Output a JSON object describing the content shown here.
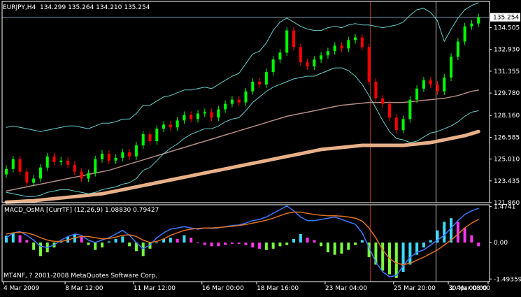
{
  "chart_data": [
    {
      "type": "line",
      "title": "EURJPY,H4",
      "ohlc_header": "134.299 135.264 134.210 135.254",
      "ylim": [
        121.86,
        136.4
      ],
      "yticks": [
        "134.505",
        "132.930",
        "131.355",
        "129.780",
        "128.160",
        "126.585",
        "125.010",
        "123.435",
        "121.860"
      ],
      "ytick_values": [
        134.505,
        132.93,
        131.355,
        129.78,
        128.16,
        126.585,
        125.01,
        123.435,
        121.86
      ],
      "current_price": "135.254",
      "current_price_value": 135.254,
      "close": [
        124.3,
        125.0,
        124.1,
        123.3,
        123.6,
        124.4,
        125.2,
        124.8,
        124.9,
        124.6,
        124.1,
        123.6,
        124.0,
        125.0,
        125.4,
        124.9,
        125.1,
        125.5,
        125.2,
        126.0,
        126.8,
        126.3,
        127.2,
        127.5,
        127.3,
        127.8,
        128.2,
        127.9,
        128.3,
        128.4,
        128.0,
        128.6,
        129.0,
        129.3,
        129.1,
        129.9,
        130.6,
        130.4,
        131.3,
        132.2,
        132.7,
        134.3,
        133.1,
        132.0,
        131.7,
        132.2,
        132.5,
        132.8,
        133.2,
        133.0,
        133.6,
        133.8,
        133.1,
        130.6,
        129.4,
        129.0,
        128.0,
        127.1,
        127.9,
        129.3,
        130.1,
        130.7,
        130.4,
        129.9,
        130.9,
        132.4,
        133.5,
        134.6,
        134.8,
        135.25
      ],
      "bands_upper": [
        127.3,
        127.4,
        127.3,
        127.2,
        127.1,
        127.0,
        127.1,
        127.2,
        127.3,
        127.4,
        127.4,
        127.3,
        127.2,
        127.4,
        127.6,
        127.6,
        127.7,
        127.9,
        127.9,
        128.3,
        128.9,
        128.9,
        129.2,
        129.5,
        129.6,
        129.8,
        130.0,
        130.0,
        130.1,
        130.2,
        130.1,
        130.4,
        130.7,
        131.0,
        131.2,
        131.9,
        132.6,
        132.8,
        133.4,
        134.3,
        134.9,
        135.2,
        134.9,
        134.6,
        134.4,
        134.3,
        134.3,
        134.5,
        134.6,
        134.5,
        134.7,
        134.8,
        134.7,
        134.7,
        134.6,
        134.5,
        134.6,
        134.7,
        134.9,
        135.4,
        135.8,
        135.9,
        135.6,
        135.0,
        133.5,
        134.4,
        135.2,
        135.8,
        136.1,
        136.3
      ],
      "bands_lower": [
        122.6,
        122.5,
        122.4,
        122.3,
        122.3,
        122.4,
        122.6,
        122.7,
        122.8,
        122.8,
        122.7,
        122.6,
        122.5,
        122.6,
        122.8,
        122.9,
        123.0,
        123.2,
        123.3,
        123.6,
        124.2,
        124.4,
        124.9,
        125.4,
        125.8,
        126.1,
        126.5,
        126.8,
        127.0,
        127.2,
        127.2,
        127.4,
        127.7,
        127.9,
        128.0,
        128.5,
        129.1,
        129.5,
        129.9,
        130.2,
        130.4,
        130.6,
        130.8,
        130.9,
        131.0,
        131.0,
        131.2,
        131.4,
        131.6,
        131.6,
        131.4,
        131.0,
        130.4,
        129.6,
        128.7,
        127.8,
        127.0,
        126.5,
        126.4,
        126.2,
        126.3,
        126.6,
        126.9,
        127.0,
        127.2,
        127.4,
        127.7,
        128.1,
        128.4,
        128.5
      ],
      "sma_slow": [
        122.7,
        122.8,
        122.9,
        123.0,
        123.1,
        123.2,
        123.3,
        123.4,
        123.5,
        123.6,
        123.7,
        123.8,
        123.9,
        124.0,
        124.1,
        124.2,
        124.35,
        124.5,
        124.65,
        124.8,
        124.95,
        125.1,
        125.25,
        125.4,
        125.55,
        125.7,
        125.85,
        126.0,
        126.15,
        126.3,
        126.45,
        126.6,
        126.75,
        126.9,
        127.05,
        127.2,
        127.35,
        127.5,
        127.65,
        127.8,
        127.95,
        128.1,
        128.2,
        128.3,
        128.4,
        128.5,
        128.6,
        128.7,
        128.8,
        128.9,
        128.95,
        129.0,
        129.05,
        129.1,
        129.1,
        129.1,
        129.1,
        129.1,
        129.1,
        129.15,
        129.2,
        129.25,
        129.3,
        129.35,
        129.4,
        129.5,
        129.6,
        129.75,
        129.9,
        130.0
      ],
      "ema_thick": [
        121.9,
        121.92,
        121.95,
        121.98,
        122.0,
        122.05,
        122.1,
        122.15,
        122.2,
        122.25,
        122.3,
        122.35,
        122.4,
        122.45,
        122.5,
        122.6,
        122.7,
        122.8,
        122.9,
        123.0,
        123.1,
        123.2,
        123.3,
        123.4,
        123.5,
        123.6,
        123.7,
        123.8,
        123.9,
        124.0,
        124.1,
        124.2,
        124.3,
        124.4,
        124.5,
        124.6,
        124.7,
        124.8,
        124.9,
        125.0,
        125.1,
        125.2,
        125.3,
        125.4,
        125.5,
        125.6,
        125.7,
        125.75,
        125.8,
        125.85,
        125.9,
        125.95,
        126.0,
        126.0,
        126.0,
        126.0,
        126.0,
        126.0,
        126.0,
        126.05,
        126.1,
        126.15,
        126.2,
        126.3,
        126.4,
        126.5,
        126.6,
        126.7,
        126.85,
        127.0
      ],
      "colors": {
        "bull": "#00ff00",
        "bear": "#ff0000",
        "bands": "#66cccc",
        "sma": "#b48c86",
        "ema": "#e8b088",
        "vline_red": "#b03c1e",
        "vline_white": "#c8c8c8",
        "price_line": "#7f9db9"
      }
    },
    {
      "type": "bar",
      "title": "MACD_OsMA [CurrTF] (12,26,9) 1.08830 0.79427",
      "ylim": [
        -1.6,
        1.55
      ],
      "yticks": [
        "1.4741",
        "0.00",
        "-1.49359"
      ],
      "ytick_values": [
        1.4741,
        0.0,
        -1.49359
      ],
      "histogram": [
        0.28,
        0.4,
        0.3,
        0.1,
        -0.3,
        -0.55,
        -0.4,
        -0.2,
        0.05,
        0.25,
        0.35,
        0.25,
        -0.1,
        -0.3,
        -0.2,
        0.05,
        0.15,
        0.25,
        -0.15,
        -0.35,
        -0.55,
        -0.25,
        0.0,
        0.15,
        0.2,
        0.15,
        0.3,
        0.2,
        0.0,
        -0.1,
        -0.15,
        -0.15,
        -0.1,
        -0.05,
        -0.05,
        -0.1,
        -0.2,
        -0.25,
        -0.3,
        -0.25,
        -0.15,
        -0.1,
        0.15,
        0.35,
        0.2,
        0.1,
        -0.15,
        -0.4,
        -0.5,
        -0.45,
        -0.3,
        -0.1,
        0.1,
        -0.6,
        -0.9,
        -1.15,
        -1.3,
        -1.45,
        -1.2,
        -0.9,
        -0.5,
        -0.2,
        0.1,
        0.5,
        0.85,
        1.0,
        0.85,
        0.6,
        0.3,
        -0.15
      ],
      "histogram_colors": [
        "#3cdcff",
        "#3cdcff",
        "#ff35f0",
        "#ff35f0",
        "#78ff3c",
        "#78ff3c",
        "#78ff3c",
        "#78ff3c",
        "#3cdcff",
        "#3cdcff",
        "#3cdcff",
        "#ff35f0",
        "#78ff3c",
        "#78ff3c",
        "#78ff3c",
        "#3cdcff",
        "#3cdcff",
        "#3cdcff",
        "#78ff3c",
        "#78ff3c",
        "#78ff3c",
        "#78ff3c",
        "#3cdcff",
        "#3cdcff",
        "#3cdcff",
        "#ff35f0",
        "#3cdcff",
        "#ff35f0",
        "#ff35f0",
        "#ff35f0",
        "#ff35f0",
        "#ff35f0",
        "#ff35f0",
        "#ff35f0",
        "#ff35f0",
        "#ff35f0",
        "#ff35f0",
        "#ff35f0",
        "#78ff3c",
        "#78ff3c",
        "#78ff3c",
        "#78ff3c",
        "#3cdcff",
        "#3cdcff",
        "#ff35f0",
        "#ff35f0",
        "#78ff3c",
        "#78ff3c",
        "#78ff3c",
        "#78ff3c",
        "#78ff3c",
        "#78ff3c",
        "#3cdcff",
        "#78ff3c",
        "#78ff3c",
        "#78ff3c",
        "#78ff3c",
        "#78ff3c",
        "#3cdcff",
        "#3cdcff",
        "#3cdcff",
        "#3cdcff",
        "#3cdcff",
        "#3cdcff",
        "#3cdcff",
        "#3cdcff",
        "#ff35f0",
        "#ff35f0",
        "#ff35f0",
        "#ff35f0"
      ],
      "macd": [
        0.2,
        0.4,
        0.45,
        0.3,
        0.1,
        -0.15,
        -0.2,
        -0.1,
        0.1,
        0.25,
        0.35,
        0.3,
        0.1,
        0.0,
        0.1,
        0.2,
        0.35,
        0.5,
        0.3,
        0.0,
        -0.25,
        -0.1,
        0.2,
        0.4,
        0.55,
        0.6,
        0.65,
        0.6,
        0.55,
        0.6,
        0.58,
        0.6,
        0.65,
        0.7,
        0.72,
        0.8,
        0.9,
        0.95,
        1.05,
        1.2,
        1.35,
        1.5,
        1.3,
        1.05,
        0.9,
        0.9,
        0.95,
        1.0,
        1.05,
        0.95,
        0.85,
        0.75,
        0.4,
        -0.2,
        -0.8,
        -1.2,
        -1.4,
        -1.35,
        -0.95,
        -0.6,
        -0.4,
        -0.3,
        -0.1,
        0.1,
        0.3,
        0.6,
        0.9,
        1.15,
        1.3,
        1.4
      ],
      "signal": [
        0.35,
        0.4,
        0.42,
        0.4,
        0.32,
        0.2,
        0.1,
        0.05,
        0.05,
        0.1,
        0.2,
        0.25,
        0.25,
        0.2,
        0.15,
        0.17,
        0.22,
        0.3,
        0.32,
        0.25,
        0.1,
        0.0,
        0.05,
        0.15,
        0.3,
        0.4,
        0.5,
        0.55,
        0.58,
        0.6,
        0.6,
        0.62,
        0.64,
        0.67,
        0.7,
        0.74,
        0.8,
        0.85,
        0.92,
        1.0,
        1.1,
        1.2,
        1.25,
        1.25,
        1.2,
        1.15,
        1.12,
        1.1,
        1.1,
        1.08,
        1.05,
        1.0,
        0.88,
        0.6,
        0.2,
        -0.3,
        -0.65,
        -0.85,
        -0.9,
        -0.85,
        -0.72,
        -0.6,
        -0.45,
        -0.3,
        -0.1,
        0.1,
        0.35,
        0.6,
        0.8,
        0.95
      ],
      "colors": {
        "macd": "#3c78ff",
        "signal": "#e07020"
      }
    }
  ],
  "xticks": [
    "4 Mar 2009",
    "8 Mar 12:00",
    "11 Mar 12:00",
    "16 Mar 00:00",
    "18 Mar 16:00",
    "23 Mar 04:00",
    "25 Mar 20:00",
    "30 Mar 08:00",
    "2 Apr 00:00"
  ],
  "copyright": "MT4NF, ? 2001-2008 MetaQuotes Software Corp."
}
